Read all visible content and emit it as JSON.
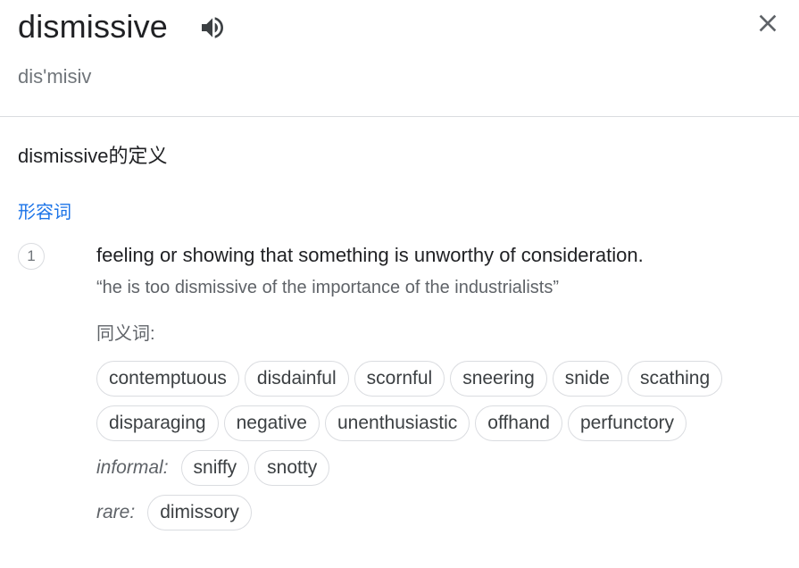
{
  "entry": {
    "word": "dismissive",
    "phonetic": "dis'misiv",
    "speaker_icon": "volume-up-icon",
    "close_icon": "close-icon"
  },
  "definition_heading": "dismissive的定义",
  "part_of_speech": "形容词",
  "sense": {
    "number": "1",
    "gloss": "feeling or showing that something is unworthy of consideration.",
    "example": "“he is too dismissive of the importance of the industrialists”"
  },
  "synonyms": {
    "label": "同义词:",
    "row1": [
      "contemptuous",
      "disdainful",
      "scornful",
      "sneering",
      "snide",
      "scathing"
    ],
    "row2": [
      "disparaging",
      "negative",
      "unenthusiastic",
      "offhand",
      "perfunctory"
    ],
    "informal_label": "informal:",
    "informal": [
      "sniffy",
      "snotty"
    ],
    "rare_label": "rare:",
    "rare": [
      "dimissory"
    ]
  },
  "colors": {
    "accent": "#1a73e8",
    "text": "#202124",
    "secondary": "#70757a",
    "border": "#dadce0"
  }
}
